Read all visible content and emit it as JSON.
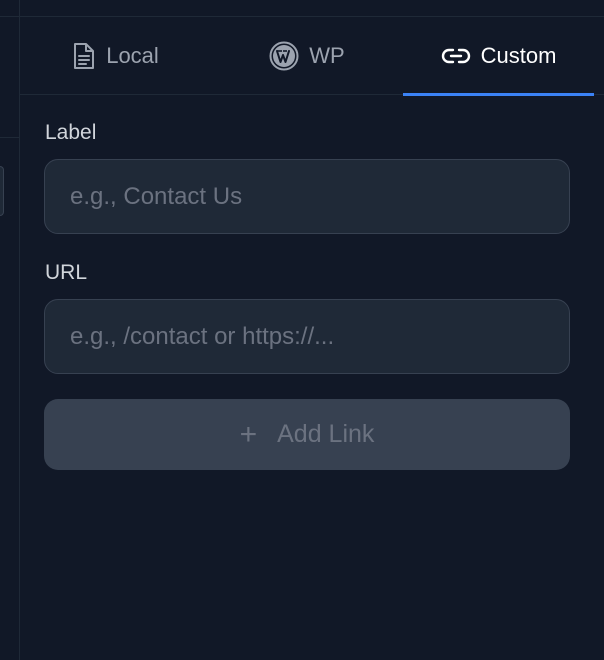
{
  "tabs": [
    {
      "label": "Local",
      "icon": "document-icon",
      "active": false
    },
    {
      "label": "WP",
      "icon": "wordpress-icon",
      "active": false
    },
    {
      "label": "Custom",
      "icon": "link-icon",
      "active": true
    }
  ],
  "form": {
    "label_field": {
      "label": "Label",
      "placeholder": "e.g., Contact Us",
      "value": ""
    },
    "url_field": {
      "label": "URL",
      "placeholder": "e.g., /contact or https://...",
      "value": ""
    },
    "add_button": {
      "icon": "plus",
      "label": "Add Link"
    }
  },
  "colors": {
    "background": "#111827",
    "input_bg": "#1f2937",
    "border": "#374151",
    "accent": "#3b82f6",
    "active_tab_text": "#ffffff",
    "muted_text": "#9ca3af"
  }
}
